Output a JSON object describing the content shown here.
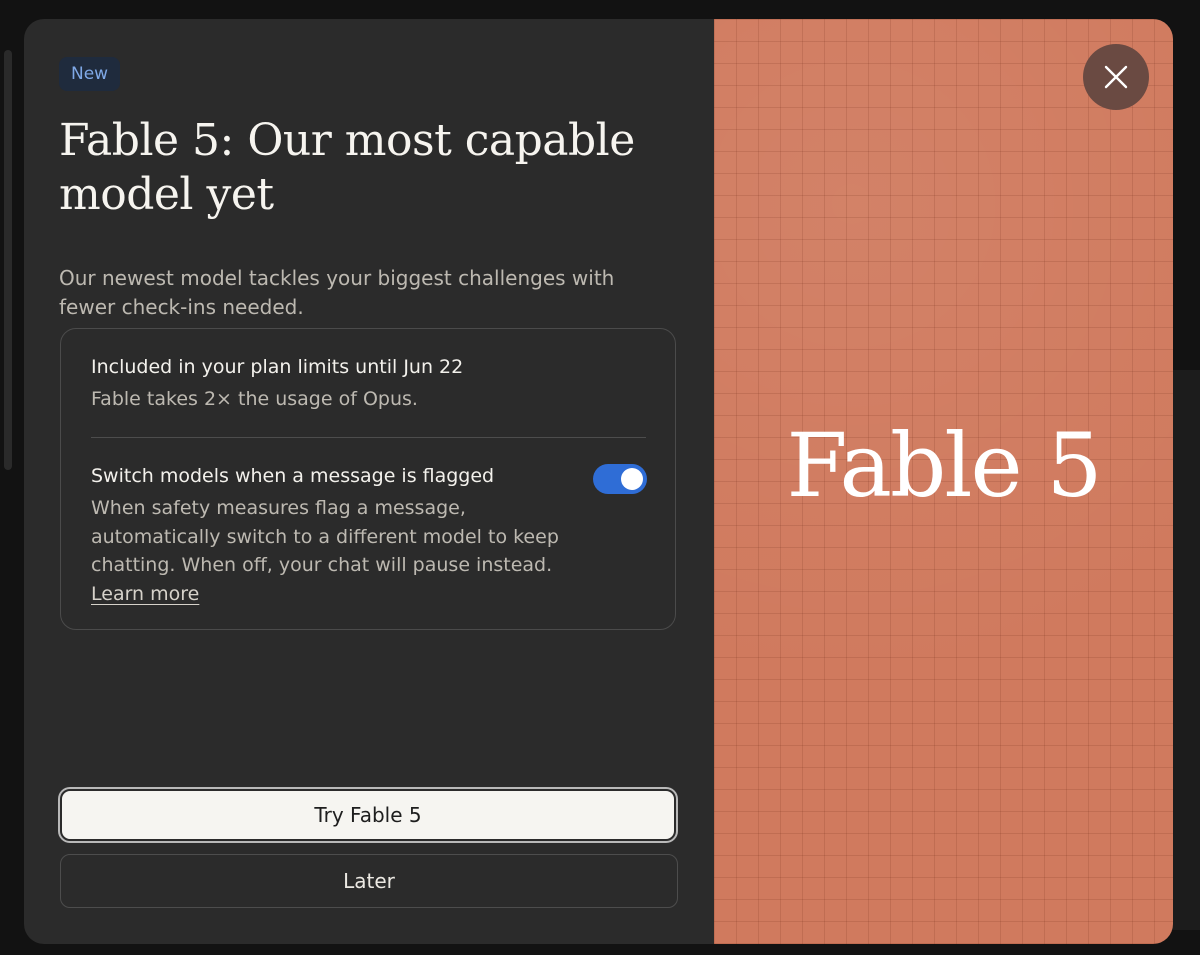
{
  "badge": "New",
  "title": "Fable 5: Our most capable model yet",
  "subtitle": "Our newest model tackles your biggest challenges with fewer check-ins needed.",
  "plan": {
    "heading": "Included in your plan limits until Jun 22",
    "text": "Fable takes 2× the usage of Opus."
  },
  "switch_setting": {
    "heading": "Switch models when a message is flagged",
    "text": "When safety measures flag a message, automatically switch to a different model to keep chatting. When off, your chat will pause instead.",
    "link": "Learn more",
    "enabled": true
  },
  "buttons": {
    "primary": "Try Fable 5",
    "secondary": "Later"
  },
  "hero": {
    "title": "Fable 5"
  },
  "colors": {
    "accent_toggle": "#2f6dd6",
    "hero_background": "#d07a5e",
    "modal_background": "#2b2b2b"
  },
  "icons": {
    "close": "close-icon"
  }
}
